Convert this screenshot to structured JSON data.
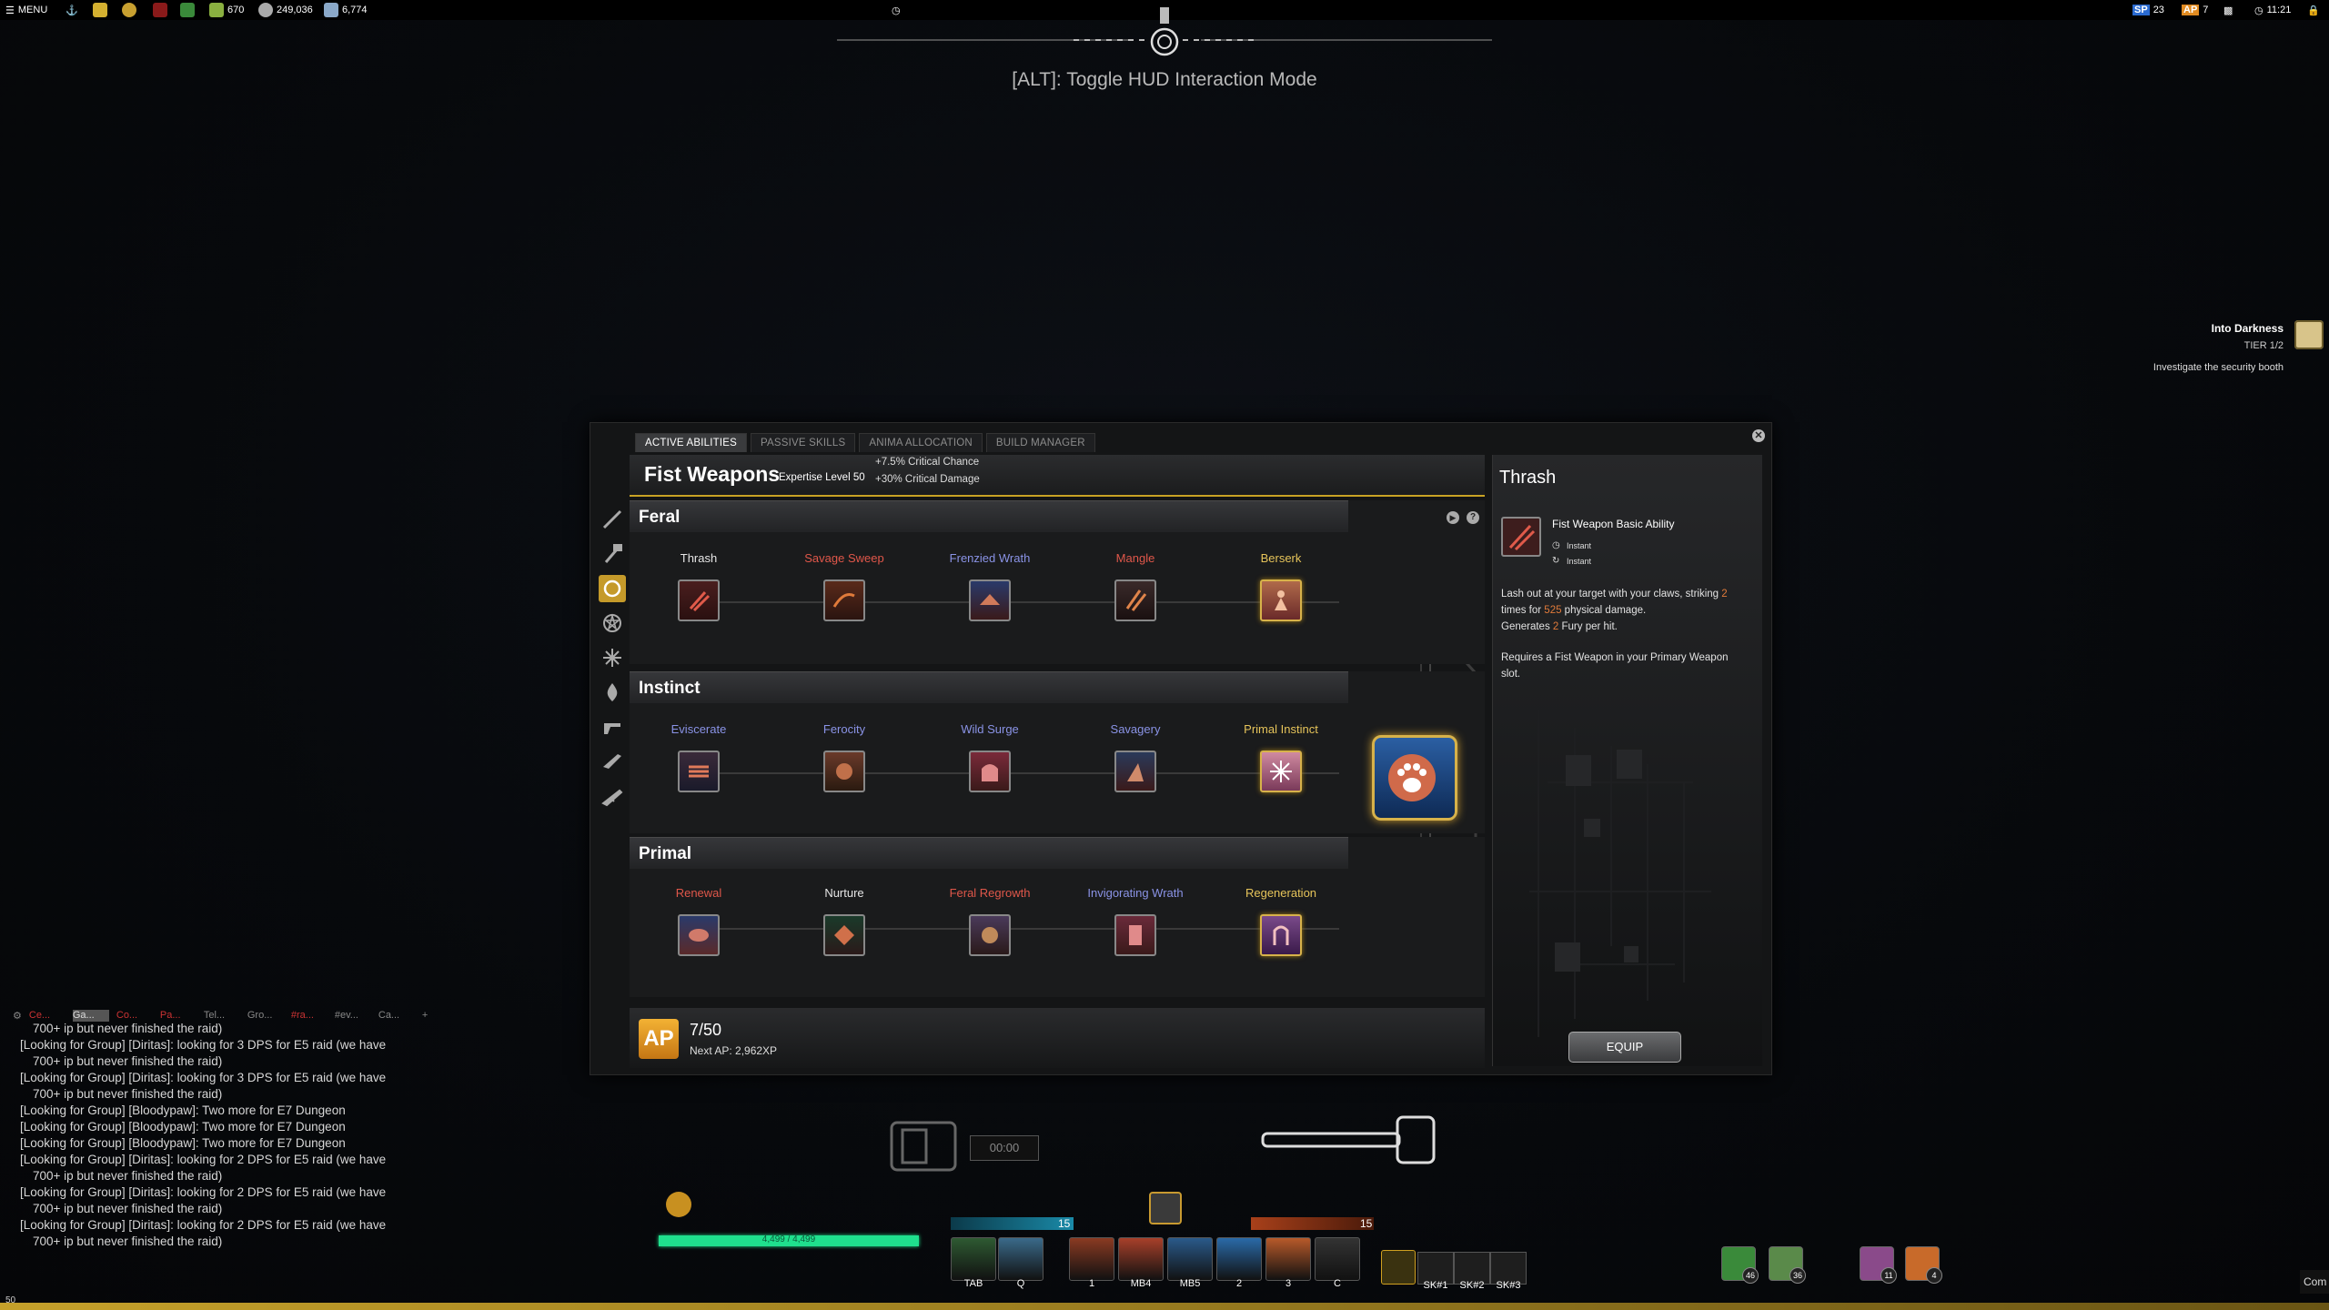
{
  "topbar": {
    "menu_label": "MENU",
    "gold": "670",
    "currency2": "249,036",
    "currency3": "6,774",
    "sp_label": "SP",
    "sp_value": "23",
    "ap_label": "AP",
    "ap_value": "7",
    "clock": "11:21"
  },
  "hud_hint": "[ALT]: Toggle HUD Interaction Mode",
  "quest": {
    "title": "Into Darkness",
    "tier": "TIER 1/2",
    "description": "Investigate the security booth"
  },
  "window": {
    "tabs": [
      {
        "label": "ACTIVE ABILITIES",
        "active": true
      },
      {
        "label": "PASSIVE SKILLS",
        "active": false
      },
      {
        "label": "ANIMA ALLOCATION",
        "active": false
      },
      {
        "label": "BUILD MANAGER",
        "active": false
      }
    ],
    "close_icon": "close-icon",
    "rail_icons": [
      "blade-icon",
      "hammer-icon",
      "fist-icon",
      "pentagram-icon",
      "chaos-icon",
      "fire-icon",
      "pistol-icon",
      "shotgun-icon",
      "rifle-icon"
    ],
    "header": {
      "title": "Fist Weapons",
      "expertise": "Expertise Level 50",
      "bonus1": "+7.5% Critical Chance",
      "bonus2": "+30% Critical Damage"
    },
    "sections": [
      {
        "title": "Feral",
        "abilities": [
          {
            "label": "Thrash",
            "color": "#e6e6e6",
            "icon": "claw-icon"
          },
          {
            "label": "Savage Sweep",
            "color": "#e0574a",
            "icon": "sweep-icon"
          },
          {
            "label": "Frenzied Wrath",
            "color": "#8a93e6",
            "icon": "wrath-icon"
          },
          {
            "label": "Mangle",
            "color": "#e0574a",
            "icon": "mangle-icon"
          },
          {
            "label": "Berserk",
            "color": "#e6c45a",
            "icon": "berserk-icon"
          }
        ]
      },
      {
        "title": "Instinct",
        "abilities": [
          {
            "label": "Eviscerate",
            "color": "#8a93e6",
            "icon": "eviscerate-icon"
          },
          {
            "label": "Ferocity",
            "color": "#8a93e6",
            "icon": "ferocity-icon"
          },
          {
            "label": "Wild Surge",
            "color": "#8a93e6",
            "icon": "surge-icon"
          },
          {
            "label": "Savagery",
            "color": "#8a93e6",
            "icon": "savagery-icon"
          },
          {
            "label": "Primal Instinct",
            "color": "#e6c45a",
            "icon": "instinct-icon"
          }
        ]
      },
      {
        "title": "Primal",
        "abilities": [
          {
            "label": "Renewal",
            "color": "#e0574a",
            "icon": "renewal-icon"
          },
          {
            "label": "Nurture",
            "color": "#e6e6e6",
            "icon": "nurture-icon"
          },
          {
            "label": "Feral Regrowth",
            "color": "#e0574a",
            "icon": "regrowth-icon"
          },
          {
            "label": "Invigorating Wrath",
            "color": "#8a93e6",
            "icon": "invigorate-icon"
          },
          {
            "label": "Regeneration",
            "color": "#e6c45a",
            "icon": "regeneration-icon"
          }
        ]
      }
    ],
    "capstone_icon": "paw-icon",
    "ap_footer": {
      "badge": "AP",
      "count": "7/50",
      "next": "Next AP: 2,962XP"
    },
    "detail": {
      "title": "Thrash",
      "type": "Fist Weapon Basic Ability",
      "cast": "Instant",
      "cooldown": "Instant",
      "desc_1": "Lash out at your target with your claws, striking ",
      "desc_2": "2",
      "desc_3": " times for ",
      "desc_4": "525",
      "desc_5": " physical damage.",
      "desc_6": "Generates ",
      "desc_7": "2",
      "desc_8": " Fury per hit.",
      "requirement": "Requires a Fist Weapon in your Primary Weapon slot.",
      "equip_label": "EQUIP"
    }
  },
  "chat": {
    "tabs": [
      "Ce...",
      "Ga...",
      "Co...",
      "Pa...",
      "Tel...",
      "Gro...",
      "#ra...",
      "#ev...",
      "Ca..."
    ],
    "lines": [
      {
        "text": "700+ ip but never finished the raid)",
        "indent": true
      },
      {
        "text": "[Looking for Group] [Diritas]: looking for 3 DPS for E5 raid (we have",
        "indent": false
      },
      {
        "text": "700+ ip but never finished the raid)",
        "indent": true
      },
      {
        "text": "[Looking for Group] [Diritas]: looking for 3 DPS for E5 raid (we have",
        "indent": false
      },
      {
        "text": "700+ ip but never finished the raid)",
        "indent": true
      },
      {
        "text": "[Looking for Group] [Bloodypaw]: Two more for E7 Dungeon",
        "indent": false
      },
      {
        "text": "[Looking for Group] [Bloodypaw]: Two more for E7 Dungeon",
        "indent": false
      },
      {
        "text": "[Looking for Group] [Bloodypaw]: Two more for E7 Dungeon",
        "indent": false
      },
      {
        "text": "[Looking for Group] [Diritas]: looking for 2 DPS for E5 raid (we have",
        "indent": false
      },
      {
        "text": "700+ ip but never finished the raid)",
        "indent": true
      },
      {
        "text": "[Looking for Group] [Diritas]: looking for 2 DPS for E5 raid (we have",
        "indent": false
      },
      {
        "text": "700+ ip but never finished the raid)",
        "indent": true
      },
      {
        "text": "[Looking for Group] [Diritas]: looking for 2 DPS for E5 raid (we have",
        "indent": false
      },
      {
        "text": "700+ ip but never finished the raid)",
        "indent": true
      }
    ]
  },
  "hud": {
    "timer": "00:00",
    "hp": "4,499 / 4,499",
    "resource_left": "15",
    "resource_right": "15",
    "hotbar_keys": [
      "TAB",
      "Q",
      "1",
      "MB4",
      "MB5",
      "2",
      "3",
      "C"
    ],
    "hotbar_colors": [
      "#2e5a32",
      "#3a6a8a",
      "#8a3a22",
      "#a8402a",
      "#2a5a8a",
      "#2a6aa8",
      "#b85a2a",
      "#333"
    ],
    "sk_keys": [
      "SK#1",
      "SK#2",
      "SK#3"
    ],
    "right_slots": [
      {
        "color": "#3a8a3a",
        "count": "46"
      },
      {
        "color": "#5a8a4a",
        "count": "36"
      },
      {
        "color": "#8a4a8a",
        "count": "11"
      },
      {
        "color": "#c86a2a",
        "count": "4"
      }
    ],
    "level": "50"
  }
}
